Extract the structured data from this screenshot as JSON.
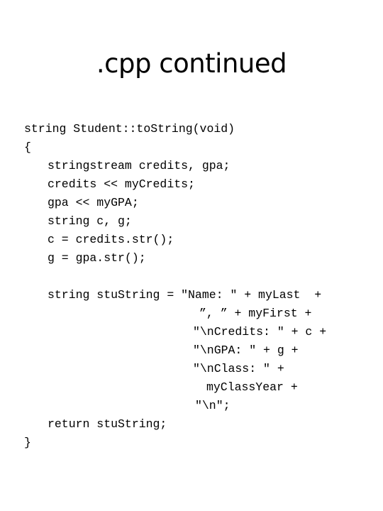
{
  "slide": {
    "title": ".cpp continued",
    "code_lines": [
      "string Student::toString(void)",
      "{",
      "stringstream credits, gpa;",
      "credits << myCredits;",
      "gpa << myGPA;",
      "string c, g;",
      "c = credits.str();",
      "g = gpa.str();",
      "string stuString = \"Name: \" + myLast  +",
      "”, ” + myFirst +",
      "\"\\nCredits: \" + c +",
      "\"\\nGPA: \" + g +",
      "\"\\nClass: \" +",
      "myClassYear +",
      "\"\\n\";",
      "return stuString;",
      "}"
    ]
  }
}
